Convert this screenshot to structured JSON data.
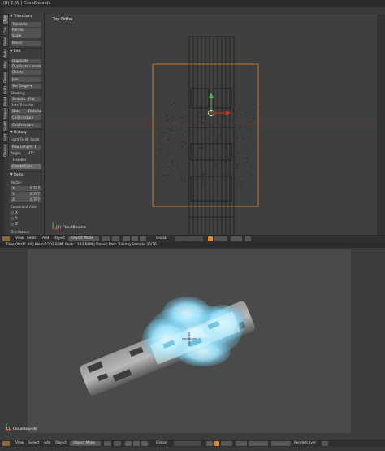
{
  "window": {
    "title": "(B) 2.69 | CloudBounds"
  },
  "vertical_tabs": [
    "Tools",
    "Create",
    "Relations",
    "Animation",
    "Physics",
    "Grease Pencil",
    "Quick Fur",
    "Import",
    "Build",
    "Retopo"
  ],
  "vertical_tabs_short": [
    "Too",
    "Cre",
    "Rela",
    "Anim",
    "Phy",
    "Grease",
    "Arch",
    "Read",
    "Import",
    "Shatt",
    "Sort",
    "Obscurer"
  ],
  "toolshelf": {
    "transform": {
      "header": "▼ Transform",
      "buttons": [
        "Translate",
        "Rotate",
        "Scale",
        "Mirror"
      ]
    },
    "edit": {
      "header": "▼ Edit",
      "buttons": [
        "Duplicate",
        "Duplicate Linked",
        "Delete",
        "Join"
      ],
      "set_origin": "Set Origin ▾",
      "shading_label": "Shading:",
      "shading_smooth": "Smooth",
      "shading_flat": "Flat",
      "data_transfer": "Data Transfer",
      "data": "Data",
      "data_layout": "Data La",
      "cell_fracture_1": "Cell Fracture",
      "cell_fracture_2": "Cell Fracture"
    },
    "history": {
      "header": "▼ History",
      "items": [
        "Light Field: Scale",
        "Raw Length: 1",
        "Angle:",
        "Handler",
        "Create Curv..."
      ],
      "angle_value": "45°"
    },
    "redo": {
      "header": "▼ Redo",
      "vector_label": "Vector",
      "x_label": "X:",
      "x_value": "0.707",
      "y_label": "Y:",
      "y_value": "0.707",
      "z_label": "Z:",
      "z_value": "0.707",
      "constraint_label": "Constraint Axis",
      "axes": [
        "X",
        "Y",
        "Z"
      ],
      "orientation_label": "Orientation"
    }
  },
  "viewport3d": {
    "label": "Top Ortho",
    "object_name": "(1) CloudBounds"
  },
  "header_top": {
    "view": "View",
    "select": "Select",
    "add": "Add",
    "object": "Object",
    "mode": "Object Mode",
    "pivot": "Global"
  },
  "render_status": "Time:00:05.44 | Mem:1203.66M, Peak:1203.66M | Done | Path Tracing Sample 36/36",
  "render_view": {
    "object_name": "(1) CloudBounds"
  },
  "header_bottom": {
    "view": "View",
    "select": "Select",
    "add": "Add",
    "object": "Object",
    "mode": "Object Mode",
    "pivot": "Global",
    "layer": "RenderLayer"
  },
  "colors": {
    "background": "#393939",
    "viewport": "#3f3f3f",
    "header": "#2f2f2f",
    "accent_orange": "#e58a2c",
    "cloud": "#9fe6ff",
    "mesh": "#9b9b9b"
  }
}
